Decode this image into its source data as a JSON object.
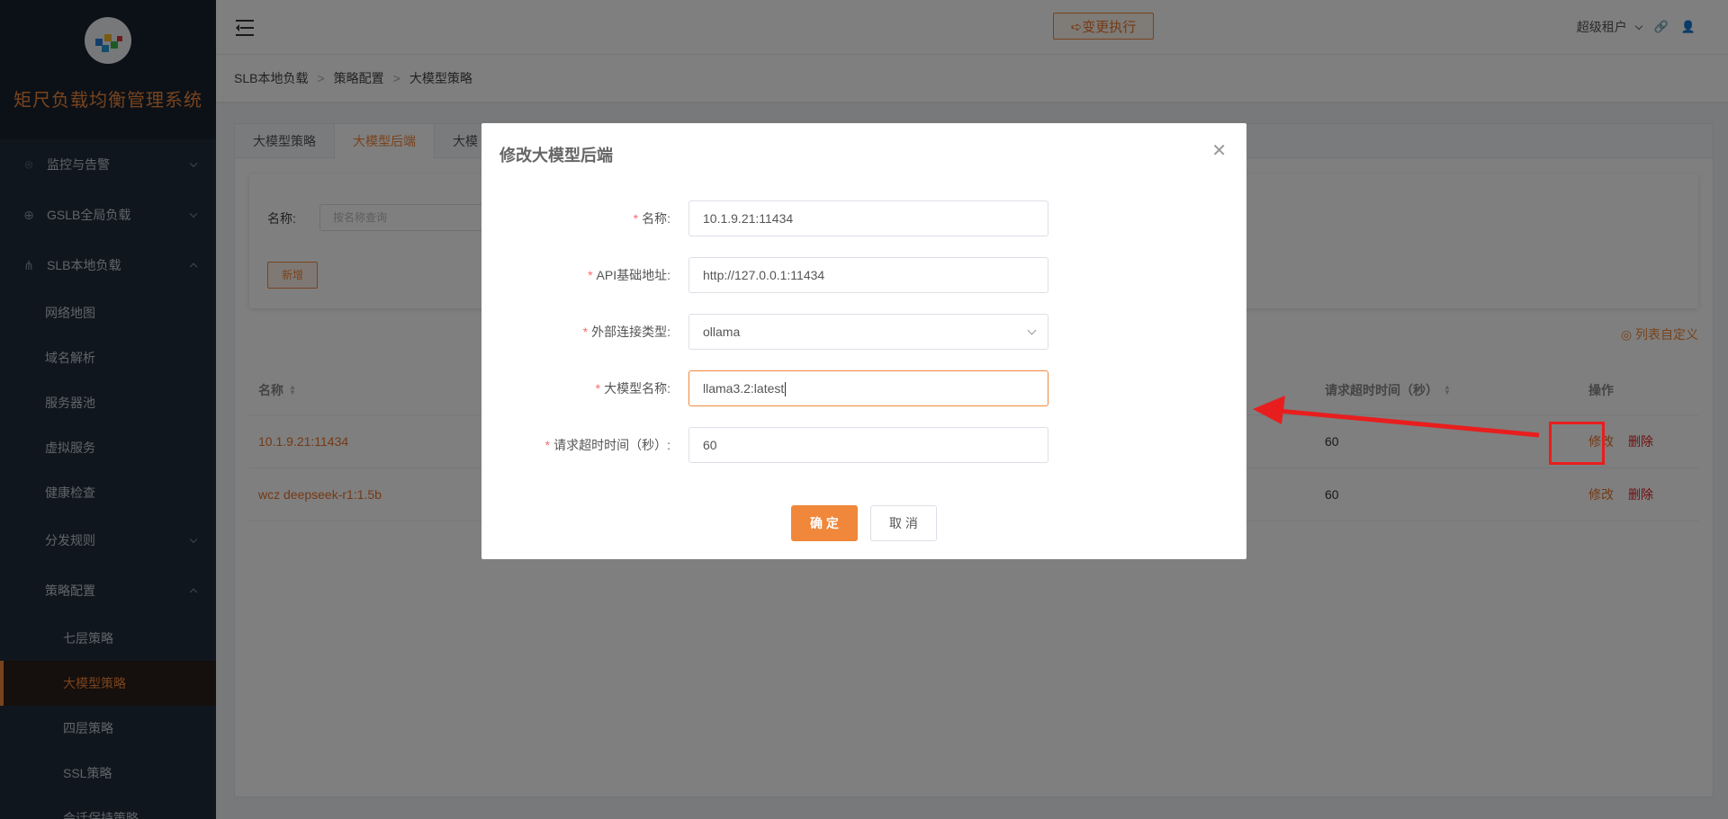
{
  "sidebar": {
    "title": "矩尺负载均衡管理系统",
    "menu": [
      {
        "label": "监控与告警",
        "icon": "location-pin-icon"
      },
      {
        "label": "GSLB全局负载",
        "icon": "globe-icon"
      },
      {
        "label": "SLB本地负载",
        "icon": "share-nodes-icon"
      }
    ],
    "slb_sub": [
      "网络地图",
      "域名解析",
      "服务器池",
      "虚拟服务",
      "健康检查",
      "分发规则",
      "策略配置"
    ],
    "policy_sub": [
      "七层策略",
      "大模型策略",
      "四层策略",
      "SSL策略",
      "会话保持策略"
    ]
  },
  "topbar": {
    "change_label": "➪变更执行",
    "tenant": "超级租户"
  },
  "breadcrumb": [
    "SLB本地负载",
    "策略配置",
    "大模型策略"
  ],
  "tabs": [
    "大模型策略",
    "大模型后端",
    "大模"
  ],
  "search": {
    "label": "名称:",
    "placeholder": "按名称查询",
    "add_label": "新增"
  },
  "column_custom": "◎ 列表自定义",
  "table": {
    "headers": {
      "name": "名称",
      "timeout": "请求超时时间（秒）",
      "ops": "操作"
    },
    "rows": [
      {
        "name": "10.1.9.21:11434",
        "timeout": "60",
        "edit": "修改",
        "delete": "删除"
      },
      {
        "name": "wcz deepseek-r1:1.5b",
        "timeout": "60",
        "edit": "修改",
        "delete": "删除"
      }
    ]
  },
  "dialog": {
    "title": "修改大模型后端",
    "fields": [
      {
        "label": "名称:",
        "value": "10.1.9.21:11434"
      },
      {
        "label": "API基础地址:",
        "value": "http://127.0.0.1:11434"
      },
      {
        "label": "外部连接类型:",
        "value": "ollama"
      },
      {
        "label": "大模型名称:",
        "value": "llama3.2:latest"
      },
      {
        "label": "请求超时时间（秒）:",
        "value": "60"
      }
    ],
    "ok_label": "确 定",
    "cancel_label": "取 消"
  },
  "colors": {
    "accent": "#f0873a",
    "danger": "#e02020",
    "annotation": "#e81e1e"
  }
}
